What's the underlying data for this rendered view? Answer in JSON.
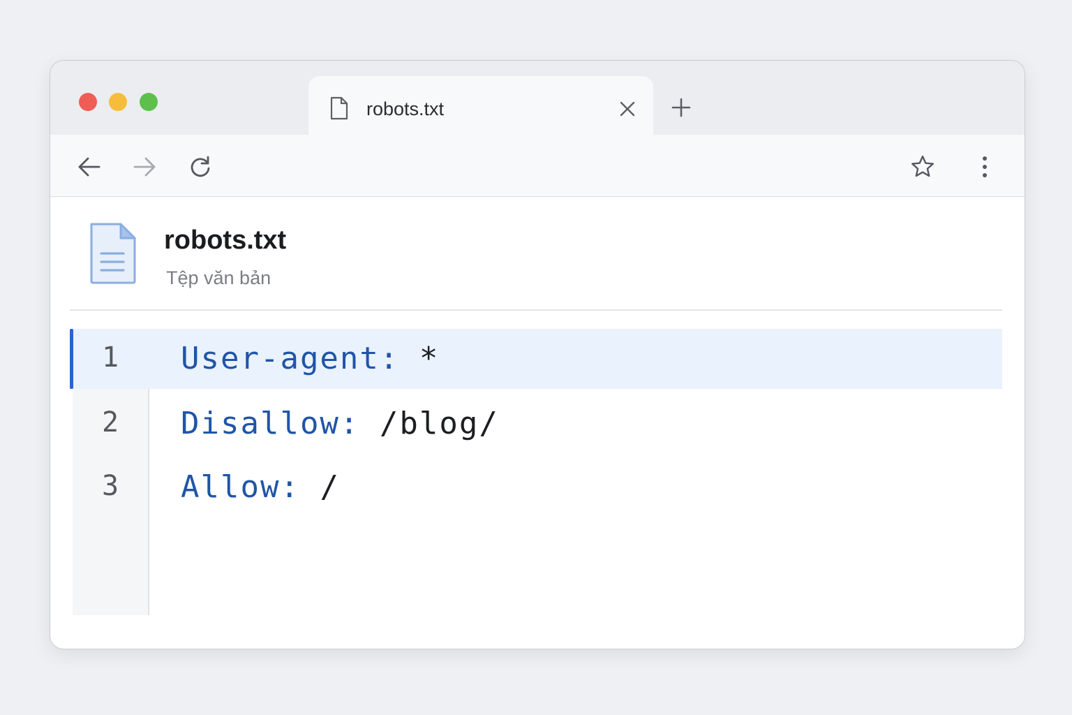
{
  "tab": {
    "title": "robots.txt"
  },
  "file": {
    "name": "robots.txt",
    "type": "Tệp văn bản"
  },
  "editor": {
    "lines": [
      {
        "number": "1",
        "key": "User-agent:",
        "value": "*",
        "active": true
      },
      {
        "number": "2",
        "key": "Disallow:",
        "value": "/blog/",
        "active": false
      },
      {
        "number": "3",
        "key": "Allow:",
        "value": "/",
        "active": false
      }
    ]
  },
  "icons": {
    "window_controls": [
      "close-dot",
      "minimize-dot",
      "maximize-dot"
    ],
    "tab": [
      "file-icon",
      "close-icon"
    ],
    "new_tab": "plus-icon",
    "toolbar": [
      "back-arrow-icon",
      "forward-arrow-icon",
      "reload-icon",
      "star-icon",
      "more-vertical-icon"
    ],
    "document": "text-document-icon"
  },
  "colors": {
    "accent": "#2a64d2",
    "keyword": "#1f55a8",
    "active_line_bg": "#eaf2fd",
    "close_dot": "#ee5e57",
    "minimize_dot": "#f6bd3b",
    "maximize_dot": "#5dc04c"
  }
}
